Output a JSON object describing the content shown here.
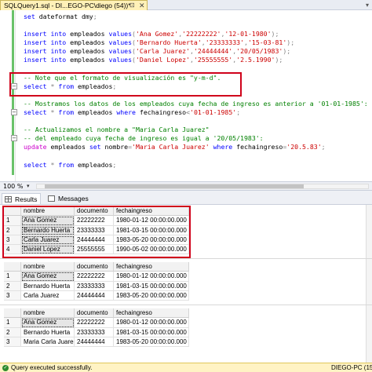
{
  "tab": {
    "title": "SQLQuery1.sql - DI...EGO-PC\\diego (54))*",
    "pin": "⊡",
    "close": "✕",
    "menu": "▾"
  },
  "editor": {
    "lines": [
      [
        {
          "t": "set",
          "c": "kw"
        },
        {
          "t": " dateformat dmy",
          "c": ""
        },
        {
          "t": ";",
          "c": "gr"
        }
      ],
      [],
      [
        {
          "t": "insert into",
          "c": "kw"
        },
        {
          "t": " empleados ",
          "c": ""
        },
        {
          "t": "values",
          "c": "kw"
        },
        {
          "t": "(",
          "c": "gr"
        },
        {
          "t": "'Ana Gomez'",
          "c": "st"
        },
        {
          "t": ",",
          "c": "gr"
        },
        {
          "t": "'22222222'",
          "c": "st"
        },
        {
          "t": ",",
          "c": "gr"
        },
        {
          "t": "'12-01-1980'",
          "c": "st"
        },
        {
          "t": ");",
          "c": "gr"
        }
      ],
      [
        {
          "t": "insert into",
          "c": "kw"
        },
        {
          "t": " empleados ",
          "c": ""
        },
        {
          "t": "values",
          "c": "kw"
        },
        {
          "t": "(",
          "c": "gr"
        },
        {
          "t": "'Bernardo Huerta'",
          "c": "st"
        },
        {
          "t": ",",
          "c": "gr"
        },
        {
          "t": "'23333333'",
          "c": "st"
        },
        {
          "t": ",",
          "c": "gr"
        },
        {
          "t": "'15-03-81'",
          "c": "st"
        },
        {
          "t": ");",
          "c": "gr"
        }
      ],
      [
        {
          "t": "insert into",
          "c": "kw"
        },
        {
          "t": " empleados ",
          "c": ""
        },
        {
          "t": "values",
          "c": "kw"
        },
        {
          "t": "(",
          "c": "gr"
        },
        {
          "t": "'Carla Juarez'",
          "c": "st"
        },
        {
          "t": ",",
          "c": "gr"
        },
        {
          "t": "'24444444'",
          "c": "st"
        },
        {
          "t": ",",
          "c": "gr"
        },
        {
          "t": "'20/05/1983'",
          "c": "st"
        },
        {
          "t": ");",
          "c": "gr"
        }
      ],
      [
        {
          "t": "insert into",
          "c": "kw"
        },
        {
          "t": " empleados ",
          "c": ""
        },
        {
          "t": "values",
          "c": "kw"
        },
        {
          "t": "(",
          "c": "gr"
        },
        {
          "t": "'Daniel Lopez'",
          "c": "st"
        },
        {
          "t": ",",
          "c": "gr"
        },
        {
          "t": "'25555555'",
          "c": "st"
        },
        {
          "t": ",",
          "c": "gr"
        },
        {
          "t": "'2.5.1990'",
          "c": "st"
        },
        {
          "t": ");",
          "c": "gr"
        }
      ],
      [],
      [
        {
          "t": "-- Note que el formato de visualización es \"y-m-d\".",
          "c": "cm"
        }
      ],
      [
        {
          "t": "select",
          "c": "kw"
        },
        {
          "t": " ",
          "c": ""
        },
        {
          "t": "*",
          "c": "gr"
        },
        {
          "t": " ",
          "c": ""
        },
        {
          "t": "from",
          "c": "kw"
        },
        {
          "t": " empleados",
          "c": ""
        },
        {
          "t": ";",
          "c": "gr"
        }
      ],
      [],
      [
        {
          "t": "-- Mostramos los datos de los empleados cuya fecha de ingreso es anterior a '01-01-1985':",
          "c": "cm"
        }
      ],
      [
        {
          "t": "select",
          "c": "kw"
        },
        {
          "t": " ",
          "c": ""
        },
        {
          "t": "*",
          "c": "gr"
        },
        {
          "t": " ",
          "c": ""
        },
        {
          "t": "from",
          "c": "kw"
        },
        {
          "t": " empleados ",
          "c": ""
        },
        {
          "t": "where",
          "c": "kw"
        },
        {
          "t": " fechaingreso",
          "c": ""
        },
        {
          "t": "<",
          "c": "gr"
        },
        {
          "t": "'01-01-1985'",
          "c": "st"
        },
        {
          "t": ";",
          "c": "gr"
        }
      ],
      [],
      [
        {
          "t": "-- Actualizamos el nombre a \"Maria Carla Juarez\"",
          "c": "cm"
        }
      ],
      [
        {
          "t": "-- del empleado cuya fecha de ingreso es igual a '20/05/1983':",
          "c": "cm"
        }
      ],
      [
        {
          "t": "update",
          "c": "fn"
        },
        {
          "t": " empleados ",
          "c": ""
        },
        {
          "t": "set",
          "c": "kw"
        },
        {
          "t": " nombre",
          "c": ""
        },
        {
          "t": "=",
          "c": "gr"
        },
        {
          "t": "'Maria Carla Juarez'",
          "c": "st"
        },
        {
          "t": " ",
          "c": ""
        },
        {
          "t": "where",
          "c": "kw"
        },
        {
          "t": " fechaingreso",
          "c": ""
        },
        {
          "t": "=",
          "c": "gr"
        },
        {
          "t": "'20.5.83'",
          "c": "st"
        },
        {
          "t": ";",
          "c": "gr"
        }
      ],
      [],
      [
        {
          "t": "select",
          "c": "kw"
        },
        {
          "t": " ",
          "c": ""
        },
        {
          "t": "*",
          "c": "gr"
        },
        {
          "t": " ",
          "c": ""
        },
        {
          "t": "from",
          "c": "kw"
        },
        {
          "t": " empleados",
          "c": ""
        },
        {
          "t": ";",
          "c": "gr"
        }
      ]
    ]
  },
  "zoom": {
    "level": "100 %",
    "arrow": "▾"
  },
  "result_tabs": [
    {
      "label": "Results"
    },
    {
      "label": "Messages"
    }
  ],
  "result_sets": [
    {
      "columns": [
        "nombre",
        "documento",
        "fechaingreso"
      ],
      "rows": [
        [
          "1",
          "Ana Gomez",
          "22222222",
          "1980-01-12 00:00:00.000"
        ],
        [
          "2",
          "Bernardo Huerta",
          "23333333",
          "1981-03-15 00:00:00.000"
        ],
        [
          "3",
          "Carla Juarez",
          "24444444",
          "1983-05-20 00:00:00.000"
        ],
        [
          "4",
          "Daniel Lopez",
          "25555555",
          "1990-05-02 00:00:00.000"
        ]
      ]
    },
    {
      "columns": [
        "nombre",
        "documento",
        "fechaingreso"
      ],
      "rows": [
        [
          "1",
          "Ana Gomez",
          "22222222",
          "1980-01-12 00:00:00.000"
        ],
        [
          "2",
          "Bernardo Huerta",
          "23333333",
          "1981-03-15 00:00:00.000"
        ],
        [
          "3",
          "Carla Juarez",
          "24444444",
          "1983-05-20 00:00:00.000"
        ]
      ]
    },
    {
      "columns": [
        "nombre",
        "documento",
        "fechaingreso"
      ],
      "rows": [
        [
          "1",
          "Ana Gomez",
          "22222222",
          "1980-01-12 00:00:00.000"
        ],
        [
          "2",
          "Bernardo Huerta",
          "23333333",
          "1981-03-15 00:00:00.000"
        ],
        [
          "3",
          "Maria Carla Juarez",
          "24444444",
          "1983-05-20 00:00:00.000"
        ]
      ]
    }
  ],
  "status": {
    "message": "Query executed successfully.",
    "server": "DIEGO-PC (15.0",
    "icon": "✓"
  },
  "colors": {
    "keyword": "#0000ff",
    "string": "#cc0000",
    "comment": "#008000",
    "highlight_box": "#d0021b",
    "status_bar": "#fff3c4"
  }
}
